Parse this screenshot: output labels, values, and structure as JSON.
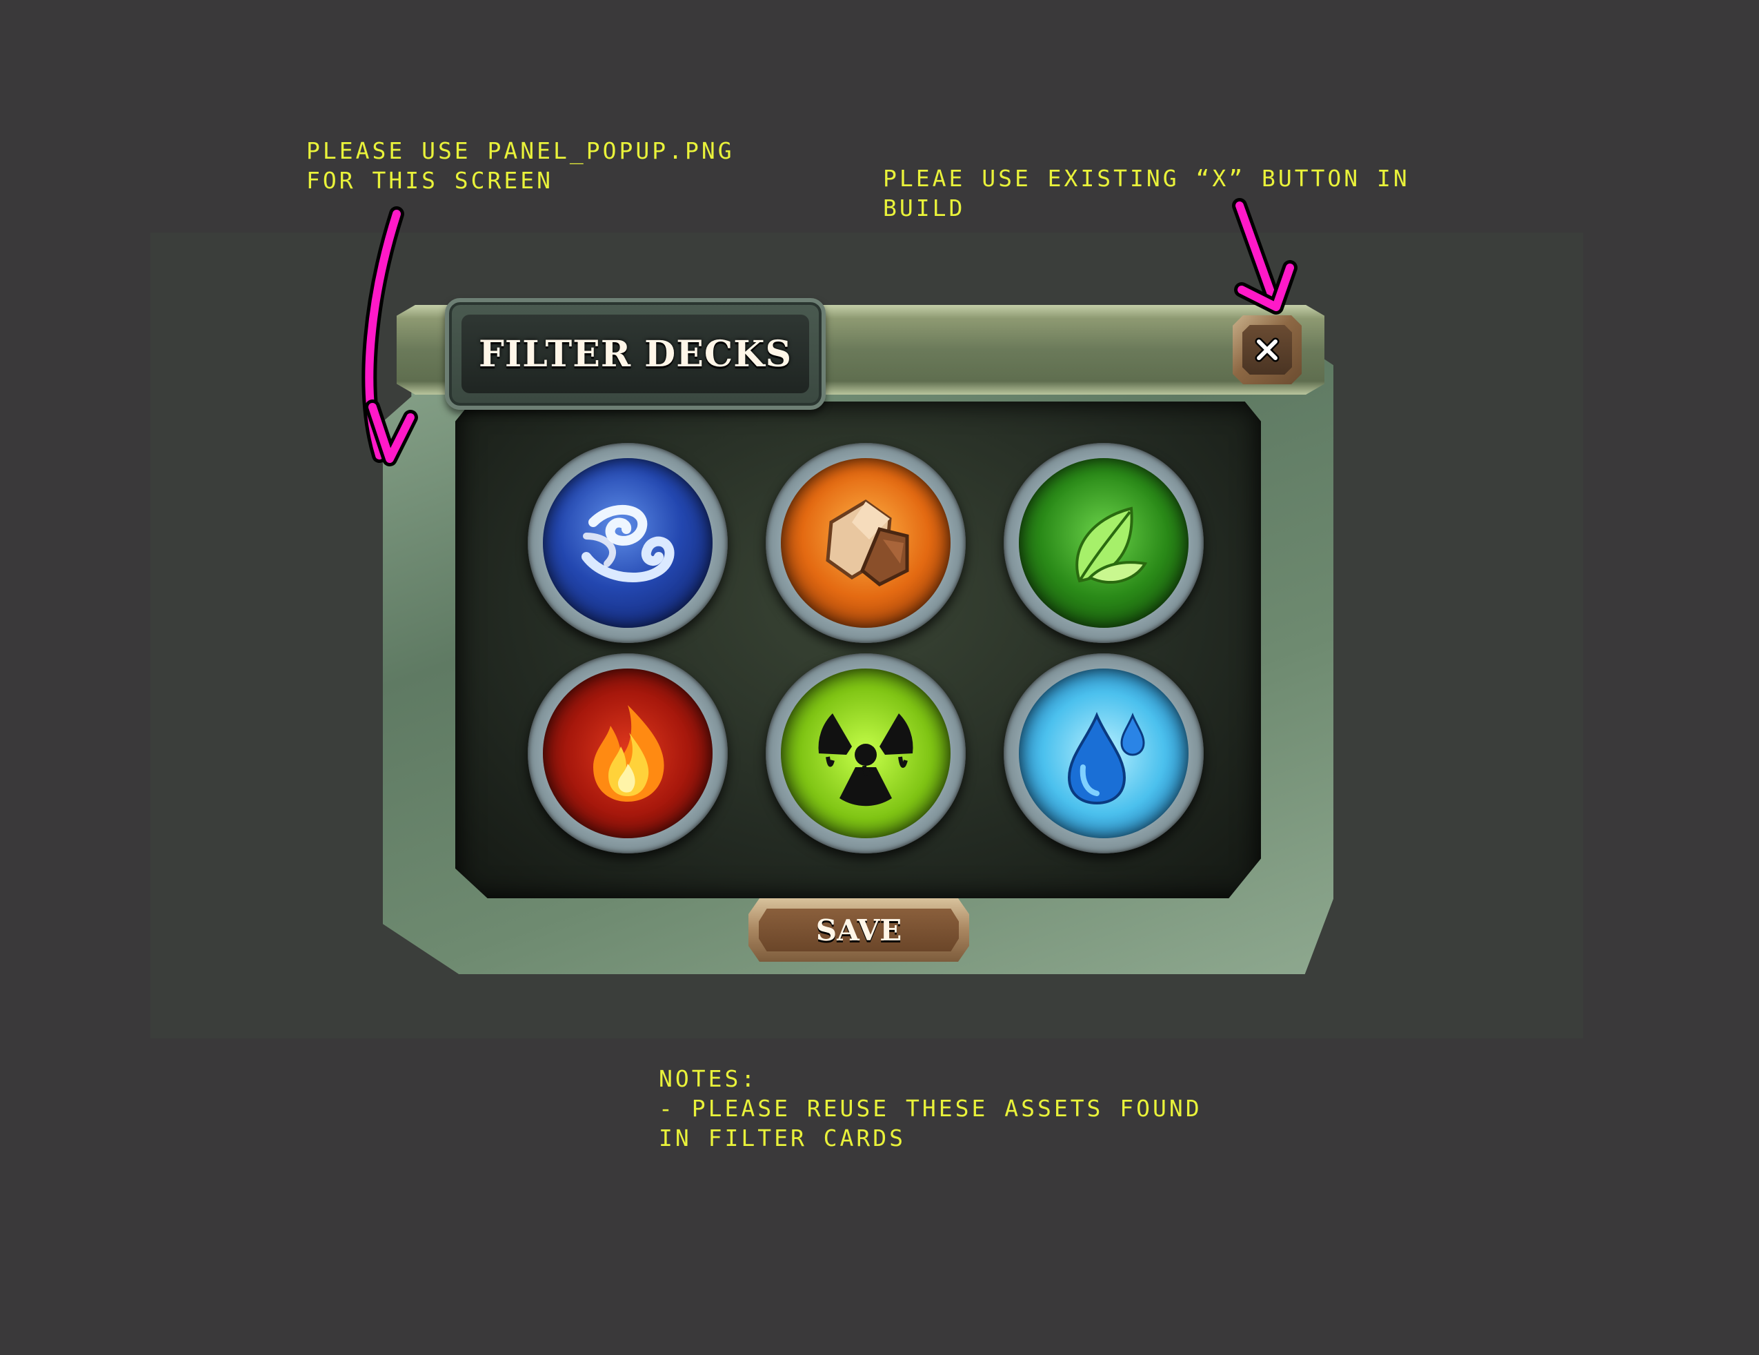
{
  "notes": {
    "panel": "PLEASE USE PANEL_POPUP.PNG\nFOR THIS SCREEN",
    "close_button": "PLEAE USE EXISTING “X” BUTTON IN\nBUILD",
    "bottom": "NOTES:\n- PLEASE REUSE THESE ASSETS FOUND\nIN FILTER CARDS"
  },
  "dialog": {
    "title": "FILTER DECKS",
    "save_label": "SAVE",
    "close_icon": "close-icon"
  },
  "elements": [
    {
      "icon": "air-icon",
      "color": "#1e3e9a"
    },
    {
      "icon": "earth-icon",
      "color": "#d8641a"
    },
    {
      "icon": "nature-icon",
      "color": "#2f8a1e"
    },
    {
      "icon": "fire-icon",
      "color": "#a8180c"
    },
    {
      "icon": "radiation-icon",
      "color": "#7fc414"
    },
    {
      "icon": "water-icon",
      "color": "#3bb4e8"
    }
  ],
  "colors": {
    "annotation_text": "#e9f23a",
    "annotation_arrow": "#ff19c8",
    "background": "#3a393a"
  }
}
